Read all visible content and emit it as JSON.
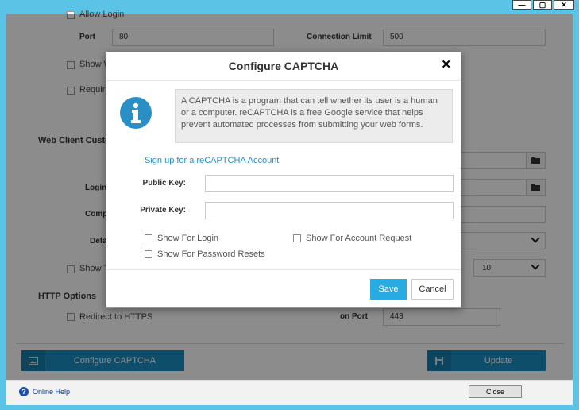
{
  "window": {
    "minimize_glyph": "—",
    "maximize_glyph": "▢",
    "close_glyph": "✕"
  },
  "background": {
    "allow_login_label": "Allow Login",
    "port_label": "Port",
    "port_value": "80",
    "connection_limit_label": "Connection Limit",
    "connection_limit_value": "500",
    "show_label_partial": "Show W",
    "require_label_partial": "Require",
    "web_client_section_partial": "Web Client Custo",
    "login_label_partial": "Login",
    "comp_label_partial": "Comp",
    "default_label_partial": "Defa",
    "show_t_partial": "Show T",
    "select_value_10": "10",
    "http_options_title": "HTTP Options",
    "redirect_https_label": "Redirect to HTTPS",
    "on_port_label": "on Port",
    "https_port_value": "443",
    "configure_captcha_button": "Configure CAPTCHA",
    "update_button": "Update"
  },
  "modal": {
    "title": "Configure CAPTCHA",
    "close_glyph": "✕",
    "info_text": "A CAPTCHA is a program that can tell whether its user is a human or a computer. reCAPTCHA is a free Google service that helps prevent automated processes from submitting your web forms.",
    "signup_link": "Sign up for a reCAPTCHA Account",
    "public_key_label": "Public Key:",
    "public_key_value": "",
    "private_key_label": "Private Key:",
    "private_key_value": "",
    "show_for_login": "Show For Login",
    "show_for_account_request": "Show For Account Request",
    "show_for_password_resets": "Show For Password Resets",
    "save_button": "Save",
    "cancel_button": "Cancel"
  },
  "footer": {
    "online_help": "Online Help",
    "close_button": "Close"
  },
  "colors": {
    "accent": "#29abe2",
    "action_button": "#1d8fc1",
    "titlebar": "#5bc4e6"
  }
}
